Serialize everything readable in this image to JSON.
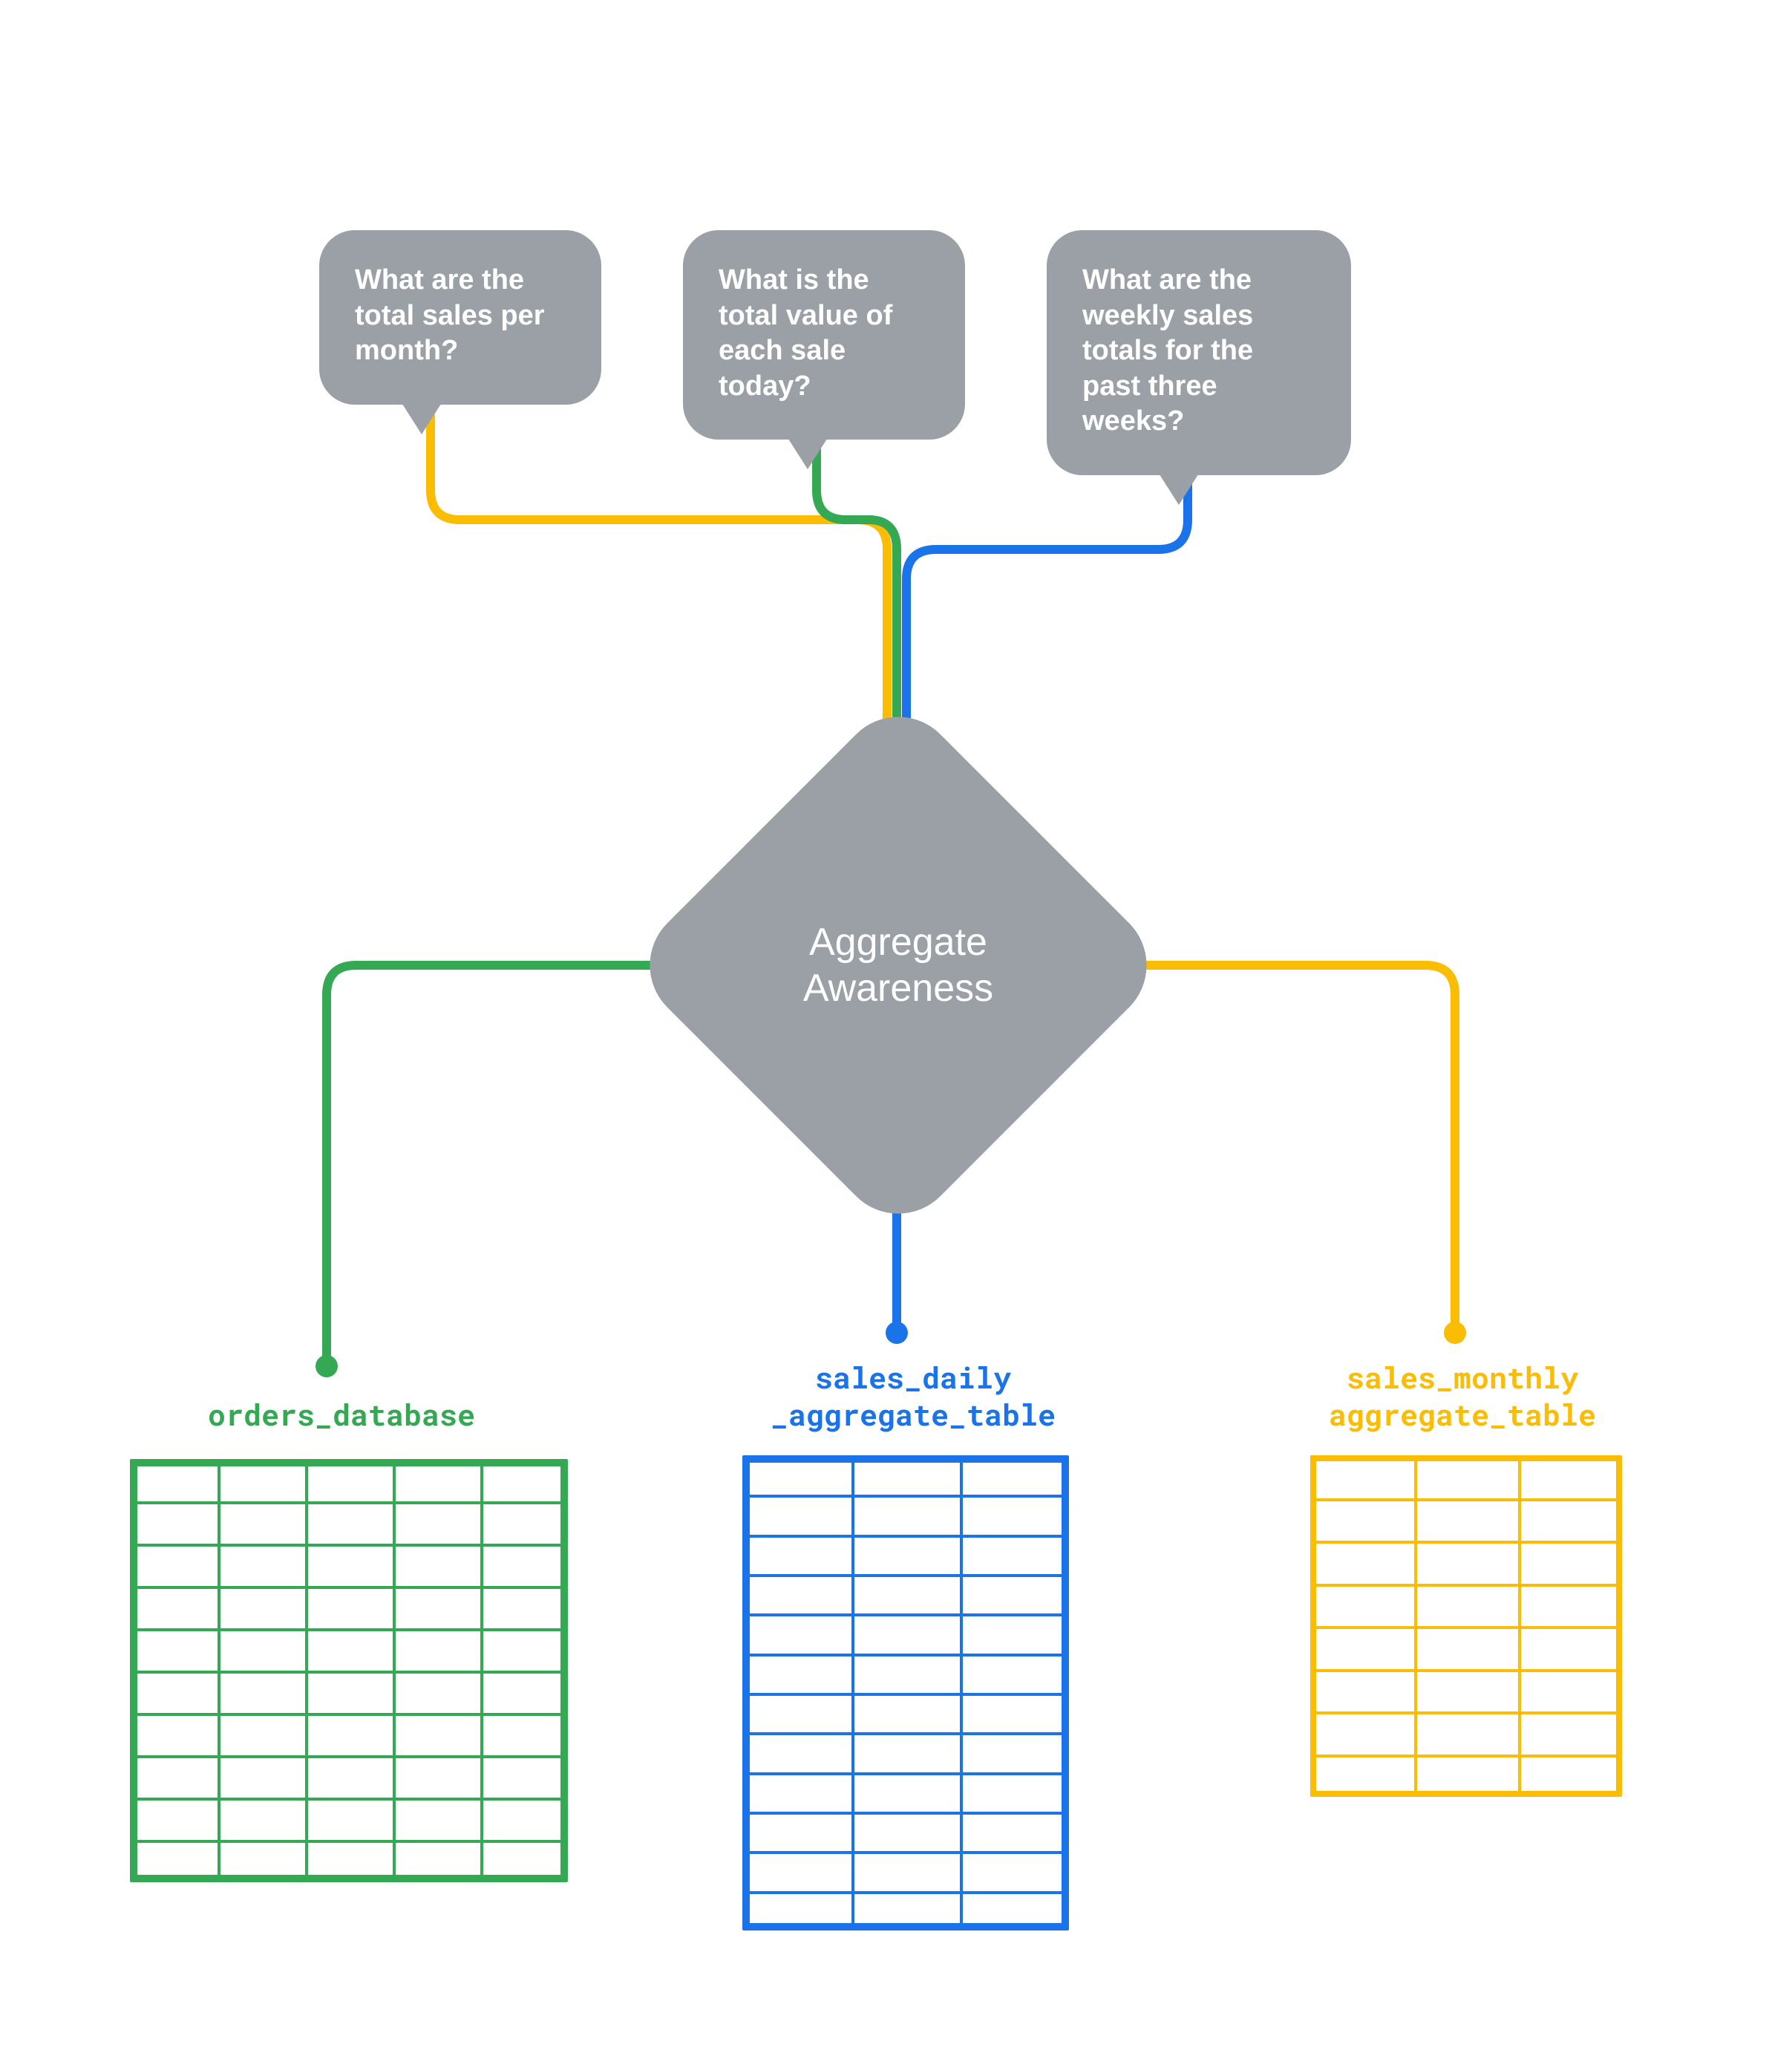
{
  "colors": {
    "grey": "#9aa0a6",
    "green": "#34a853",
    "blue": "#1a73e8",
    "yellow": "#fbbc04",
    "white": "#ffffff"
  },
  "bubbles": {
    "q1": "What are the total sales per month?",
    "q2": "What is the total value of each sale today?",
    "q3": "What are the weekly sales totals for the past three weeks?"
  },
  "center": {
    "line1": "Aggregate",
    "line2": "Awareness"
  },
  "tables": {
    "green": {
      "label": "orders_database",
      "cols": 5,
      "rows": 10
    },
    "blue": {
      "label_line1": "sales_daily",
      "label_line2": "_aggregate_table",
      "cols": 3,
      "rows": 12
    },
    "yellow": {
      "label_line1": "sales_monthly",
      "label_line2": "aggregate_table",
      "cols": 3,
      "rows": 8
    }
  }
}
